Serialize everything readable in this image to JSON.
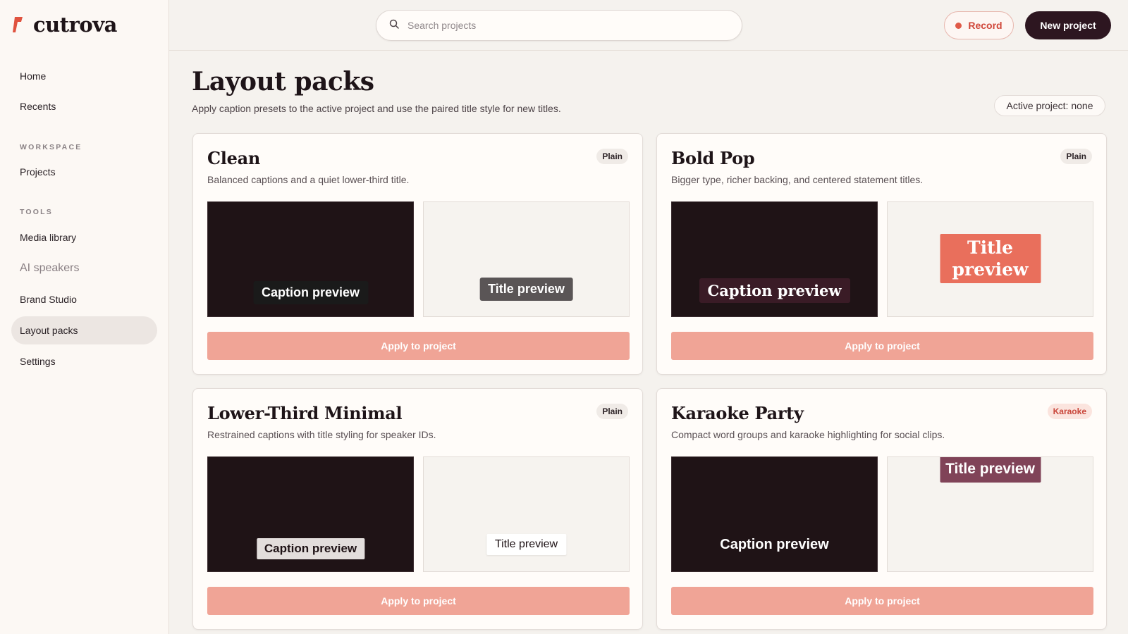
{
  "brand": {
    "name": "cutrova",
    "accent": "#e0533f"
  },
  "sidebar": {
    "items_top": [
      {
        "label": "Home"
      },
      {
        "label": "Recents"
      }
    ],
    "workspace_heading": "WORKSPACE",
    "workspace_items": [
      {
        "label": "Projects"
      }
    ],
    "tools_heading": "TOOLS",
    "tools_items": [
      {
        "label": "Media library"
      },
      {
        "label": "AI speakers"
      },
      {
        "label": "Brand Studio"
      },
      {
        "label": "Layout packs",
        "active": true
      },
      {
        "label": "Settings"
      }
    ]
  },
  "topbar": {
    "search_placeholder": "Search projects",
    "record_label": "Record",
    "new_project_label": "New project"
  },
  "page": {
    "title": "Layout packs",
    "subtitle": "Apply caption presets to the active project and use the paired title style for new titles.",
    "active_project": "Active project: none"
  },
  "packs": [
    {
      "name": "Clean",
      "description": "Balanced captions and a quiet lower-third title.",
      "badge": "Plain",
      "caption_preview": "Caption preview",
      "title_preview": "Title preview",
      "apply_label": "Apply to project"
    },
    {
      "name": "Bold Pop",
      "description": "Bigger type, richer backing, and centered statement titles.",
      "badge": "Plain",
      "caption_preview": "Caption preview",
      "title_preview": "Title preview",
      "apply_label": "Apply to project"
    },
    {
      "name": "Lower-Third Minimal",
      "description": "Restrained captions with title styling for speaker IDs.",
      "badge": "Plain",
      "caption_preview": "Caption preview",
      "title_preview": "Title preview",
      "apply_label": "Apply to project"
    },
    {
      "name": "Karaoke Party",
      "description": "Compact word groups and karaoke highlighting for social clips.",
      "badge": "Karaoke",
      "caption_preview": "Caption preview",
      "title_preview": "Title preview",
      "apply_label": "Apply to project"
    }
  ],
  "colors": {
    "apply_button": "#f0a496",
    "new_project_button": "#2d1620",
    "record_text": "#d0473a",
    "preview_dark": "#1f1316"
  }
}
